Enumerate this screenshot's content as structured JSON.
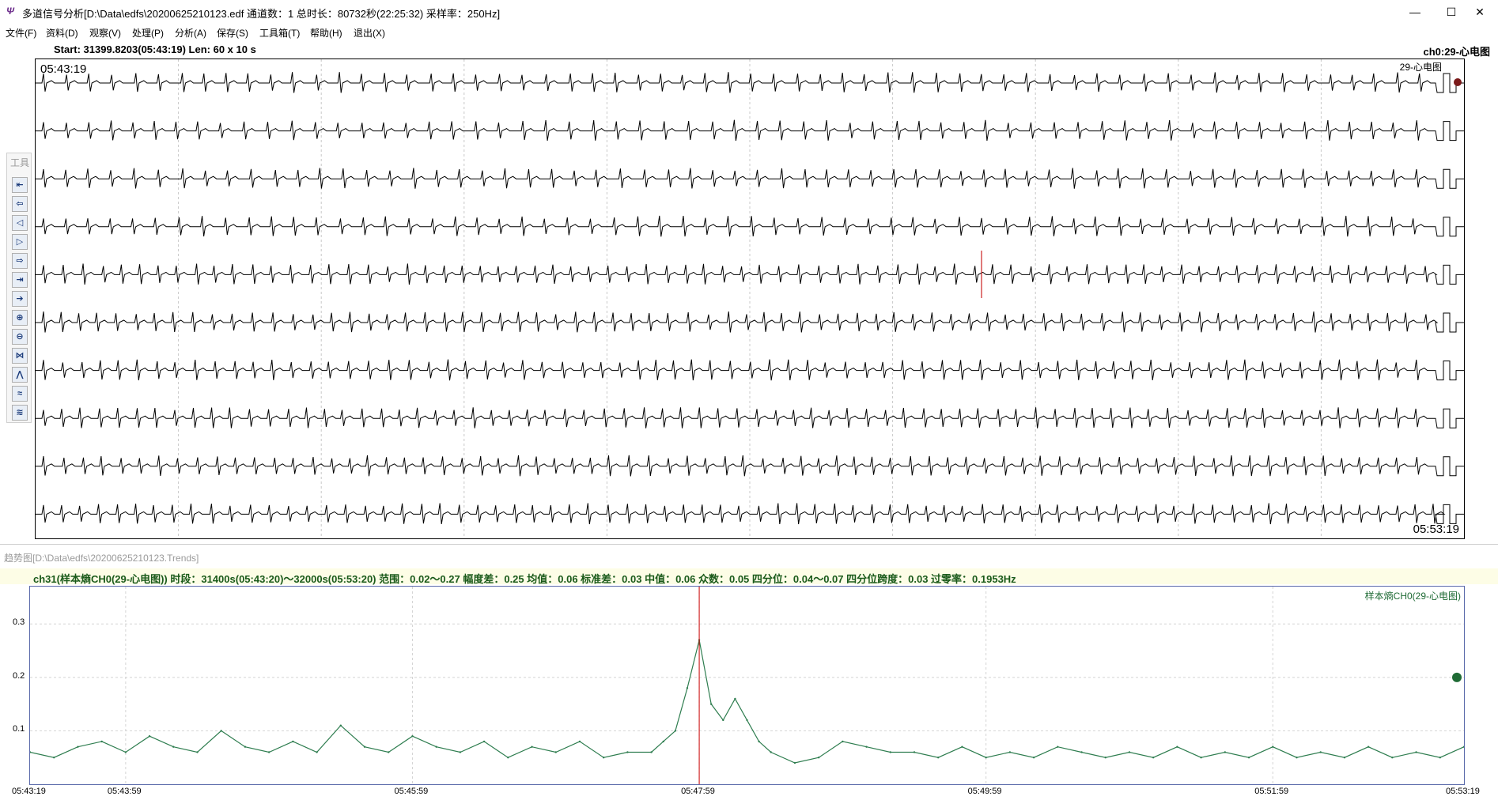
{
  "window": {
    "icon_glyph": "Ψ",
    "title": "多道信号分析[D:\\Data\\edfs\\20200625210123.edf 通道数：1  总时长：80732秒(22:25:32)  采样率：250Hz]",
    "minimize": "—",
    "maximize": "☐",
    "close": "✕"
  },
  "menu": [
    "文件(F)",
    "资料(D)",
    "观察(V)",
    "处理(P)",
    "分析(A)",
    "保存(S)",
    "工具箱(T)",
    "帮助(H)",
    "退出(X)"
  ],
  "ecg": {
    "info_left": "Start: 31399.8203(05:43:19)  Len: 60 x 10 s",
    "info_right": "ch0:29-心电图",
    "channel_label": "29-心电图",
    "start_time": "05:43:19",
    "end_time": "05:53:19",
    "marker_color": "#cc2222"
  },
  "toolbox": {
    "title": "工具",
    "tools": [
      {
        "name": "first-page-icon",
        "glyph": "⇤"
      },
      {
        "name": "prev-page-icon",
        "glyph": "⇦"
      },
      {
        "name": "step-back-icon",
        "glyph": "◁"
      },
      {
        "name": "step-forward-icon",
        "glyph": "▷"
      },
      {
        "name": "next-page-icon",
        "glyph": "⇨"
      },
      {
        "name": "forward-page-icon",
        "glyph": "⇥"
      },
      {
        "name": "last-page-icon",
        "glyph": "➔"
      },
      {
        "name": "zoom-in-icon",
        "glyph": "⊕"
      },
      {
        "name": "zoom-out-icon",
        "glyph": "⊖"
      },
      {
        "name": "compress-icon",
        "glyph": "⋈"
      },
      {
        "name": "peak-icon",
        "glyph": "⋀"
      },
      {
        "name": "amplify-icon",
        "glyph": "≈"
      },
      {
        "name": "filter-icon",
        "glyph": "≋"
      }
    ]
  },
  "trend": {
    "title": "趋势图[D:\\Data\\edfs\\20200625210123.Trends]",
    "stats": "ch31(样本熵CH0(29-心电图)) 时段：31400s(05:43:20)～32000s(05:53:20)  范围：0.02～0.27  幅度差：0.25  均值：0.06  标准差：0.03  中值：0.06  众数：0.05  四分位：0.04～0.07  四分位跨度：0.03  过零率：0.1953Hz",
    "series_label": "样本熵CH0(29-心电图)",
    "line_color": "#2e7d4f",
    "marker_color": "#1f6b35",
    "cursor_color": "#cc0000"
  },
  "chart_data": {
    "type": "line",
    "title": "",
    "xlabel": "",
    "ylabel": "",
    "x_ticks": [
      "05:43:19",
      "05:43:59",
      "05:45:59",
      "05:47:59",
      "05:49:59",
      "05:51:59",
      "05:53:19"
    ],
    "x_tick_seconds": [
      0,
      40,
      160,
      280,
      400,
      520,
      600
    ],
    "y_ticks": [
      0.1,
      0.2,
      0.3
    ],
    "ylim": [
      0,
      0.37
    ],
    "xlim": [
      0,
      600
    ],
    "cursor_x": 280,
    "grid": true,
    "series": [
      {
        "name": "样本熵CH0(29-心电图)",
        "x": [
          0,
          10,
          20,
          30,
          40,
          50,
          60,
          70,
          80,
          90,
          100,
          110,
          120,
          130,
          140,
          150,
          160,
          170,
          180,
          190,
          200,
          210,
          220,
          230,
          240,
          250,
          260,
          265,
          270,
          275,
          280,
          285,
          290,
          295,
          300,
          305,
          310,
          320,
          330,
          340,
          350,
          360,
          370,
          380,
          390,
          400,
          410,
          420,
          430,
          440,
          450,
          460,
          470,
          480,
          490,
          500,
          510,
          520,
          530,
          540,
          550,
          560,
          570,
          580,
          590,
          600
        ],
        "y": [
          0.06,
          0.05,
          0.07,
          0.08,
          0.06,
          0.09,
          0.07,
          0.06,
          0.1,
          0.07,
          0.06,
          0.08,
          0.06,
          0.11,
          0.07,
          0.06,
          0.09,
          0.07,
          0.06,
          0.08,
          0.05,
          0.07,
          0.06,
          0.08,
          0.05,
          0.06,
          0.06,
          0.08,
          0.1,
          0.18,
          0.27,
          0.15,
          0.12,
          0.16,
          0.12,
          0.08,
          0.06,
          0.04,
          0.05,
          0.08,
          0.07,
          0.06,
          0.06,
          0.05,
          0.07,
          0.05,
          0.06,
          0.05,
          0.07,
          0.06,
          0.05,
          0.06,
          0.05,
          0.07,
          0.05,
          0.06,
          0.05,
          0.07,
          0.05,
          0.06,
          0.05,
          0.07,
          0.05,
          0.06,
          0.05,
          0.07
        ]
      }
    ]
  }
}
